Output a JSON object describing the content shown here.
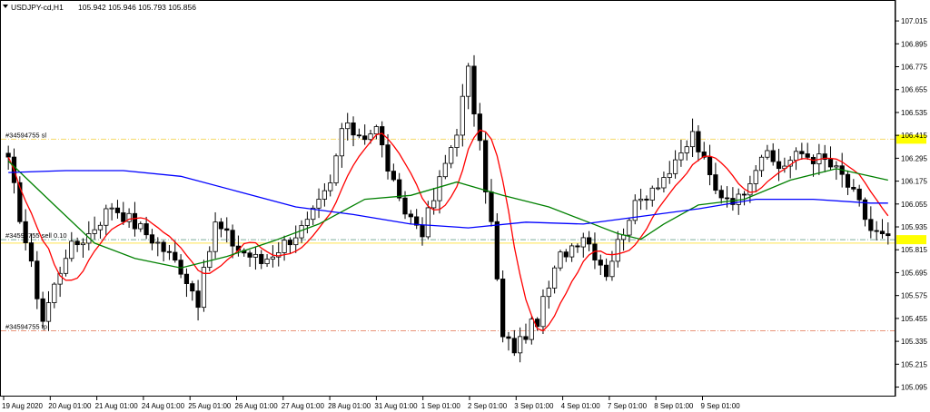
{
  "header": {
    "symbol_timeframe": "USDJPY-cd,H1",
    "ohlc": "105.942 105.946 105.793 105.856"
  },
  "chart_data": {
    "type": "candlestick",
    "symbol": "USDJPY-cd",
    "timeframe": "H1",
    "ylim": [
      105.05,
      107.12
    ],
    "y_ticks": [
      "107.015",
      "106.895",
      "106.775",
      "106.655",
      "106.535",
      "106.415",
      "106.295",
      "106.175",
      "106.055",
      "105.935",
      "105.815",
      "105.695",
      "105.575",
      "105.455",
      "105.335",
      "105.215",
      "105.095"
    ],
    "x_ticks": [
      "19 Aug 2020",
      "20 Aug 01:00",
      "21 Aug 01:00",
      "24 Aug 01:00",
      "25 Aug 01:00",
      "26 Aug 01:00",
      "27 Aug 01:00",
      "28 Aug 01:00",
      "31 Aug 01:00",
      "1 Sep 01:00",
      "2 Sep 01:00",
      "3 Sep 01:00",
      "4 Sep 01:00",
      "7 Sep 01:00",
      "8 Sep 01:00",
      "9 Sep 01:00"
    ],
    "grid": false,
    "levels": [
      {
        "name": "sl",
        "label": "#34594755 sl",
        "price": 106.395,
        "color": "#f5d96b",
        "style": "dash-dot",
        "tag_color": "#ffff00"
      },
      {
        "name": "entry",
        "label": "#34594755 sell 0.10",
        "price": 105.868,
        "color": "#7faf9f",
        "style": "dash-dot",
        "tag_color": "#ffff00"
      },
      {
        "name": "entry_band",
        "price": 105.85,
        "color": "#ffe34d",
        "style": "solid"
      },
      {
        "name": "tp",
        "label": "#34594755 tp",
        "price": 105.39,
        "color": "#e9967a",
        "style": "dash-dot"
      }
    ],
    "anchors": [
      [
        0,
        106.27
      ],
      [
        6,
        105.45
      ],
      [
        10,
        105.8
      ],
      [
        14,
        105.9
      ],
      [
        18,
        106.05
      ],
      [
        22,
        105.95
      ],
      [
        26,
        105.85
      ],
      [
        30,
        105.72
      ],
      [
        33,
        105.55
      ],
      [
        36,
        105.95
      ],
      [
        40,
        105.82
      ],
      [
        44,
        105.75
      ],
      [
        48,
        105.85
      ],
      [
        52,
        105.95
      ],
      [
        56,
        106.15
      ],
      [
        58,
        106.45
      ],
      [
        62,
        106.42
      ],
      [
        64,
        106.45
      ],
      [
        68,
        106.05
      ],
      [
        72,
        105.92
      ],
      [
        74,
        106.08
      ],
      [
        78,
        106.45
      ],
      [
        80,
        106.75
      ],
      [
        84,
        105.95
      ],
      [
        86,
        105.35
      ],
      [
        88,
        105.3
      ],
      [
        92,
        105.45
      ],
      [
        96,
        105.78
      ],
      [
        100,
        105.9
      ],
      [
        104,
        105.7
      ],
      [
        108,
        106.0
      ],
      [
        112,
        106.15
      ],
      [
        116,
        106.25
      ],
      [
        119,
        106.42
      ],
      [
        123,
        106.12
      ],
      [
        127,
        106.08
      ],
      [
        131,
        106.32
      ],
      [
        134,
        106.25
      ],
      [
        138,
        106.32
      ],
      [
        142,
        106.28
      ],
      [
        145,
        106.2
      ],
      [
        148,
        106.05
      ],
      [
        150,
        105.92
      ],
      [
        153,
        105.86
      ]
    ],
    "ma_series": [
      {
        "color": "#ff0000",
        "period": 8
      },
      {
        "color": "#008000",
        "period": 21
      },
      {
        "color": "#0000ff",
        "period": 48
      }
    ],
    "ma_blue_points": [
      [
        0,
        106.22
      ],
      [
        10,
        106.23
      ],
      [
        20,
        106.23
      ],
      [
        30,
        106.2
      ],
      [
        40,
        106.12
      ],
      [
        50,
        106.04
      ],
      [
        60,
        106.0
      ],
      [
        70,
        105.95
      ],
      [
        80,
        105.93
      ],
      [
        90,
        105.96
      ],
      [
        100,
        105.95
      ],
      [
        110,
        105.99
      ],
      [
        120,
        106.03
      ],
      [
        130,
        106.08
      ],
      [
        140,
        106.08
      ],
      [
        150,
        106.06
      ],
      [
        153,
        106.06
      ]
    ],
    "ma_green_points": [
      [
        0,
        106.28
      ],
      [
        8,
        106.05
      ],
      [
        15,
        105.85
      ],
      [
        22,
        105.77
      ],
      [
        30,
        105.72
      ],
      [
        38,
        105.78
      ],
      [
        46,
        105.86
      ],
      [
        54,
        105.95
      ],
      [
        62,
        106.08
      ],
      [
        70,
        106.1
      ],
      [
        78,
        106.17
      ],
      [
        86,
        106.1
      ],
      [
        94,
        106.04
      ],
      [
        100,
        105.97
      ],
      [
        106,
        105.9
      ],
      [
        110,
        105.87
      ],
      [
        114,
        105.95
      ],
      [
        120,
        106.05
      ],
      [
        128,
        106.08
      ],
      [
        136,
        106.18
      ],
      [
        144,
        106.24
      ],
      [
        150,
        106.2
      ],
      [
        153,
        106.18
      ]
    ]
  }
}
